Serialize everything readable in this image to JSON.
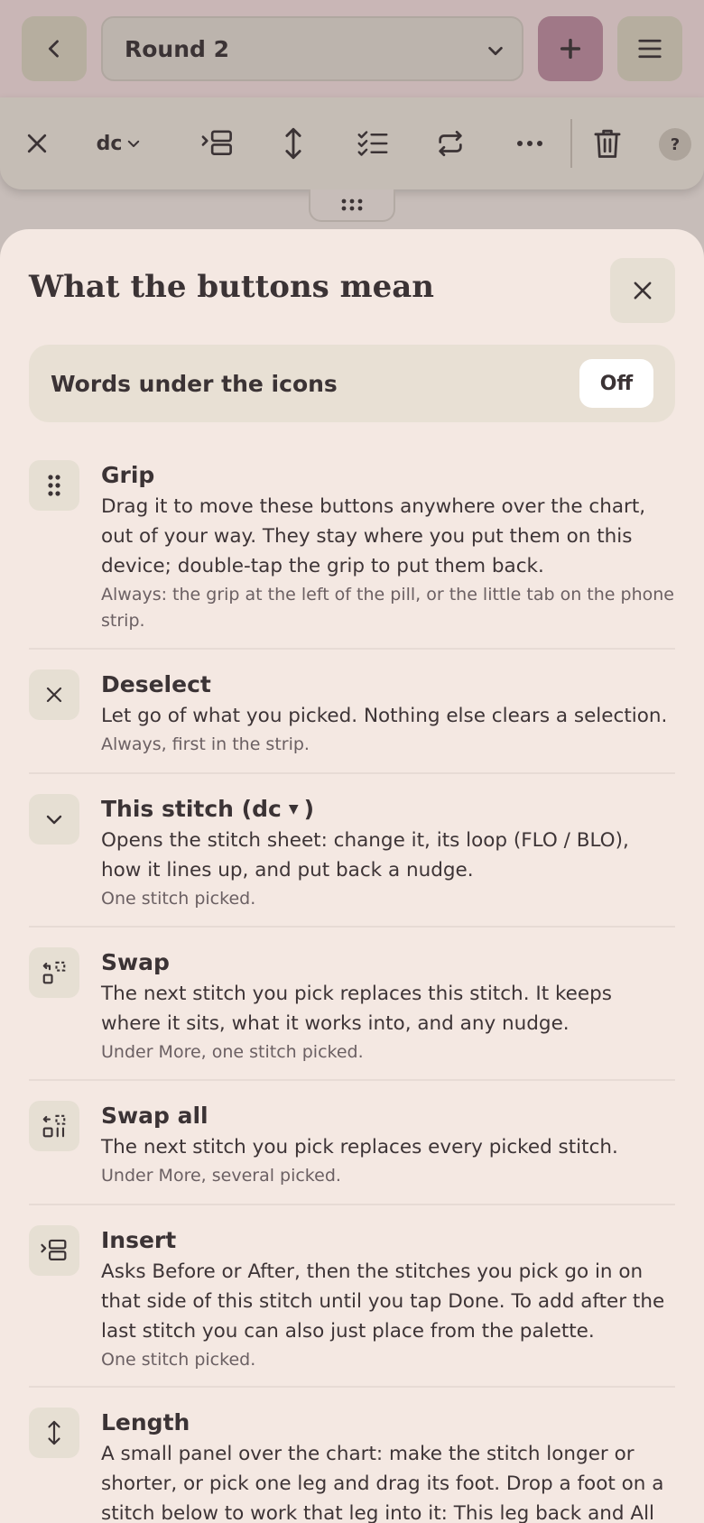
{
  "header": {
    "round_value": "Round 2",
    "add_label": "+"
  },
  "toolbar": {
    "stitch_label": "dc",
    "help_label": "?"
  },
  "sheet": {
    "title": "What the buttons mean",
    "toggle": {
      "label": "Words under the icons",
      "value": "Off"
    },
    "items": [
      {
        "title": "Grip",
        "desc": "Drag it to move these buttons anywhere over the chart, out of your way. They stay where you put them on this device; double-tap the grip to put them back.",
        "note": "Always: the grip at the left of the pill, or the little tab on the phone strip.",
        "icon": "grip-icon"
      },
      {
        "title": "Deselect",
        "desc": "Let go of what you picked. Nothing else clears a selection.",
        "note": "Always, first in the strip.",
        "icon": "close-icon"
      },
      {
        "title_prefix": "This stitch (dc",
        "title_suffix": ")",
        "desc": "Opens the stitch sheet: change it, its loop (FLO / BLO), how it lines up, and put back a nudge.",
        "note": "One stitch picked.",
        "icon": "chevron-down-icon"
      },
      {
        "title": "Swap",
        "desc": "The next stitch you pick replaces this stitch. It keeps where it sits, what it works into, and any nudge.",
        "note": "Under More, one stitch picked.",
        "icon": "swap-icon"
      },
      {
        "title": "Swap all",
        "desc": "The next stitch you pick replaces every picked stitch.",
        "note": "Under More, several picked.",
        "icon": "swap-all-icon"
      },
      {
        "title": "Insert",
        "desc": "Asks Before or After, then the stitches you pick go in on that side of this stitch until you tap Done. To add after the last stitch you can also just place from the palette.",
        "note": "One stitch picked.",
        "icon": "insert-icon"
      },
      {
        "title": "Length",
        "desc": "A small panel over the chart: make the stitch longer or shorter, or pick one leg and drag its foot. Drop a foot on a stitch below to work that leg into it: This leg back and All",
        "note": "",
        "icon": "length-icon"
      }
    ]
  }
}
